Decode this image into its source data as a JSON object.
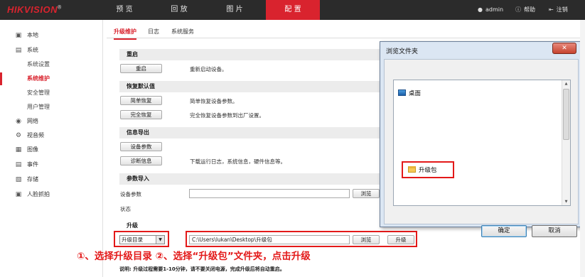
{
  "brand": {
    "logo": "HIKVISION",
    "mark": "®"
  },
  "topnav": {
    "tabs": [
      {
        "label": "预 览"
      },
      {
        "label": "回 放"
      },
      {
        "label": "图 片"
      },
      {
        "label": "配 置",
        "active": true
      }
    ],
    "user": "admin",
    "help": "帮助",
    "logout": "注销",
    "accent": "#d9232e"
  },
  "sidebar": {
    "items": [
      {
        "label": "本地",
        "icon": "monitor-icon"
      },
      {
        "label": "系统",
        "icon": "system-icon"
      },
      {
        "label": "系统设置",
        "sub": true
      },
      {
        "label": "系统维护",
        "sub": true,
        "active": true
      },
      {
        "label": "安全管理",
        "sub": true
      },
      {
        "label": "用户管理",
        "sub": true
      },
      {
        "label": "网络",
        "icon": "network-icon"
      },
      {
        "label": "视音频",
        "icon": "video-audio-icon"
      },
      {
        "label": "图像",
        "icon": "image-icon"
      },
      {
        "label": "事件",
        "icon": "event-icon"
      },
      {
        "label": "存储",
        "icon": "storage-icon"
      },
      {
        "label": "人脸抓拍",
        "icon": "face-capture-icon"
      }
    ]
  },
  "tabs": [
    {
      "label": "升级维护",
      "active": true
    },
    {
      "label": "日志"
    },
    {
      "label": "系统服务"
    }
  ],
  "reboot": {
    "title": "重启",
    "button": "重启",
    "desc": "重新启动设备。"
  },
  "restore": {
    "title": "恢复默认值",
    "simple_button": "简单恢复",
    "simple_desc": "简单恢复设备参数。",
    "full_button": "完全恢复",
    "full_desc": "完全恢复设备参数到出厂设置。"
  },
  "export": {
    "title": "信息导出",
    "params_button": "设备参数",
    "diag_button": "诊断信息",
    "diag_desc": "下载运行日志，系统信息，硬件信息等。"
  },
  "import": {
    "title": "参数导入",
    "param_label": "设备参数",
    "param_value": "",
    "browse": "浏览",
    "status_label": "状态"
  },
  "upgrade": {
    "title": "升级",
    "select_value": "升级目录",
    "path": "C:\\Users\\lukan\\Desktop\\升级包",
    "browse": "浏览",
    "upgrade_button": "升级",
    "annotation": "①、选择升级目录   ②、选择“升级包”文件夹，点击升级",
    "note": "说明: 升级过程需要1-10分钟，请不要关闭电源，完成升级后将自动重启。"
  },
  "dialog": {
    "title": "浏览文件夹",
    "close": "✕",
    "items": [
      {
        "label": "桌面",
        "icon": "desktop-icon"
      },
      {
        "label": "升级包",
        "icon": "folder-icon"
      }
    ],
    "ok": "确定",
    "cancel": "取消"
  }
}
